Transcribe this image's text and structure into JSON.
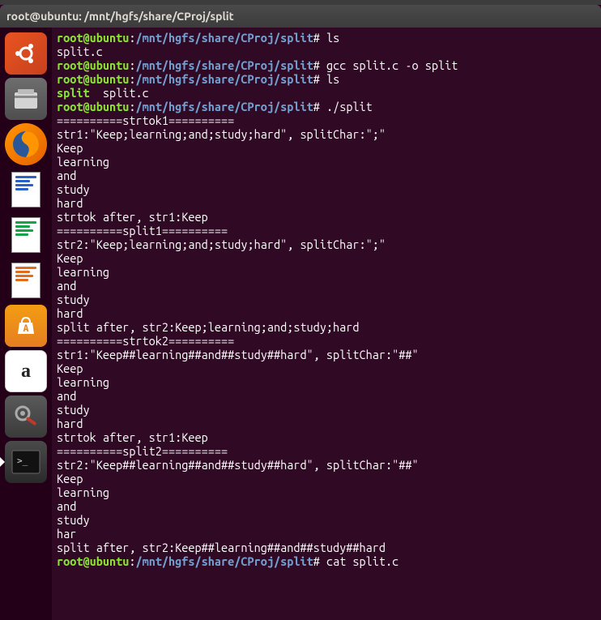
{
  "window": {
    "title": "root@ubuntu: /mnt/hgfs/share/CProj/split"
  },
  "prompt": {
    "user": "root@ubuntu",
    "colon": ":",
    "path": "/mnt/hgfs/share/CProj/split",
    "hash": "# "
  },
  "launcher": {
    "items": [
      {
        "name": "ubuntu-dash-icon"
      },
      {
        "name": "files-icon"
      },
      {
        "name": "firefox-icon"
      },
      {
        "name": "writer-icon"
      },
      {
        "name": "calc-icon"
      },
      {
        "name": "impress-icon"
      },
      {
        "name": "software-icon"
      },
      {
        "name": "amazon-icon"
      },
      {
        "name": "settings-icon"
      },
      {
        "name": "terminal-icon"
      }
    ]
  },
  "term": {
    "l1_cmd": "ls",
    "l2_file": "split.c",
    "l3_cmd": "gcc split.c -o split",
    "l4_cmd": "ls",
    "l5_exec": "split",
    "l5_gap": "  ",
    "l5_file": "split.c",
    "l6_cmd": "./split",
    "blank": "",
    "h1": "==========strtok1==========",
    "s1a": "str1:\"Keep;learning;and;study;hard\", splitChar:\";\"",
    "w_keep": "Keep",
    "w_learning": "learning",
    "w_and": "and",
    "w_study": "study",
    "w_hard": "hard",
    "w_har": "har",
    "s1b": "strtok after, str1:Keep",
    "h2": "==========split1==========",
    "s2a": "str2:\"Keep;learning;and;study;hard\", splitChar:\";\"",
    "s2b": "split after, str2:Keep;learning;and;study;hard",
    "h3": "==========strtok2==========",
    "s3a": "str1:\"Keep##learning##and##study##hard\", splitChar:\"##\"",
    "s3b": "strtok after, str1:Keep",
    "h4": "==========split2==========",
    "s4a": "str2:\"Keep##learning##and##study##hard\", splitChar:\"##\"",
    "s4b": "split after, str2:Keep##learning##and##study##hard",
    "last_cmd": "cat split.c"
  }
}
